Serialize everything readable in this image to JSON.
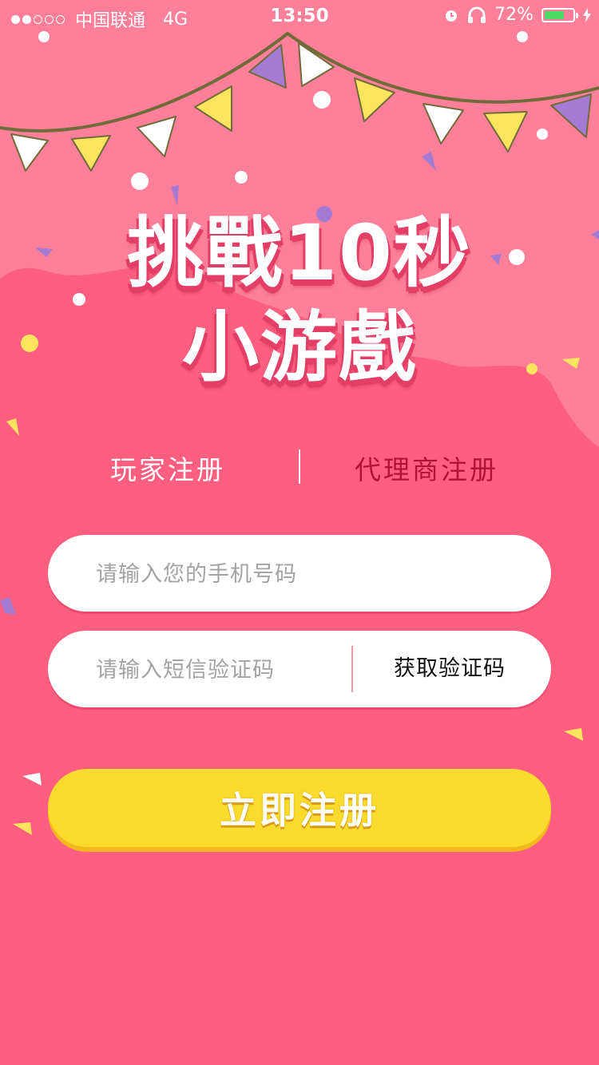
{
  "status_bar": {
    "signal_dots_filled": 2,
    "signal_dots_total": 5,
    "carrier": "中国联通",
    "network": "4G",
    "time": "13:50",
    "battery_percent_text": "72%",
    "battery_level": 0.72,
    "icons": [
      "alarm-icon",
      "headphones-icon",
      "battery-icon",
      "charging-bolt-icon"
    ]
  },
  "title": {
    "line1": "挑戰10秒",
    "line2": "小游戲"
  },
  "tabs": {
    "player": "玩家注册",
    "agent": "代理商注册"
  },
  "form": {
    "phone_placeholder": "请输入您的手机号码",
    "code_placeholder": "请输入短信验证码",
    "get_code_label": "获取验证码",
    "submit_label": "立即注册"
  },
  "colors": {
    "background": "#fe5f80",
    "top_background": "#fe7f99",
    "tab_active": "#ffffff",
    "tab_inactive": "#b01338",
    "submit_button": "#fadb2e",
    "pennant_yellow": "#fbe45e",
    "pennant_purple": "#a47ad3",
    "pennant_white": "#ffffff"
  }
}
